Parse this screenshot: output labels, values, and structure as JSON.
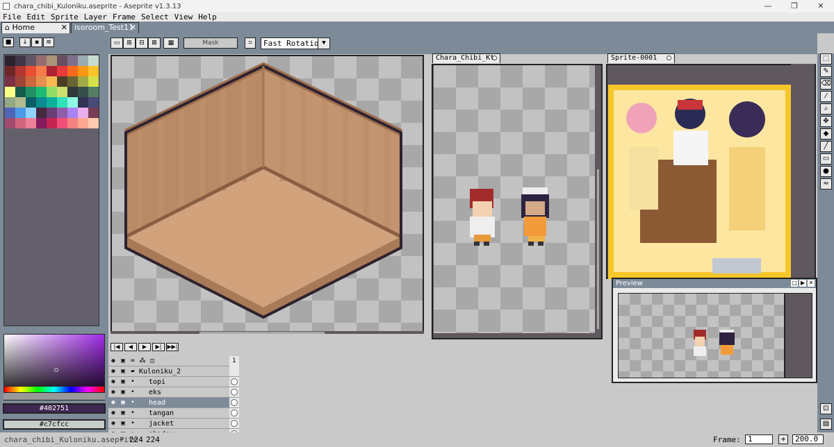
{
  "window": {
    "title": "chara_chibi_Kuloniku.aseprite - Aseprite v1.3.13",
    "controls": [
      "—",
      "❐",
      "✕"
    ]
  },
  "menu": [
    "File",
    "Edit",
    "Sprite",
    "Layer",
    "Frame",
    "Select",
    "View",
    "Help"
  ],
  "tabs": [
    {
      "label": "Home",
      "close": "✕"
    },
    {
      "label": "isoroom_Test11",
      "close": "✕"
    }
  ],
  "toolbar": {
    "mask_label": "Mask",
    "rotation_value": "Fast Rotation"
  },
  "doc_tabs": [
    "Chara_Chibi_Kt",
    "Sprite-0001"
  ],
  "colors": {
    "foreground_hex": "#402751",
    "background_hex": "#c7cfcc",
    "accent": "#7d8b99"
  },
  "palette": [
    "#2e222f",
    "#3e3546",
    "#625565",
    "#966c6c",
    "#ab947a",
    "#694f62",
    "#7f708a",
    "#9babb2",
    "#c7dcd0",
    "#6e2727",
    "#b33831",
    "#ea4f36",
    "#f57d4a",
    "#ae2334",
    "#e83b3b",
    "#fb6b1d",
    "#f79617",
    "#f9c22b",
    "#7a3045",
    "#9e4539",
    "#cd683d",
    "#e6904e",
    "#fbb954",
    "#4c3e24",
    "#676633",
    "#a2a947",
    "#d5e04b",
    "#fbff86",
    "#165a4c",
    "#239063",
    "#1ebc73",
    "#91db69",
    "#cddf6c",
    "#313638",
    "#374e4a",
    "#547e64",
    "#92a984",
    "#b2ba90",
    "#0b5e65",
    "#0b8a8f",
    "#0eaf9b",
    "#30e1b9",
    "#8ff8e2",
    "#323353",
    "#484a77",
    "#4d65b4",
    "#4d9be6",
    "#8fd3ff",
    "#45293f",
    "#6b3e75",
    "#905ea9",
    "#a884f3",
    "#eaaded",
    "#753c54",
    "#a24b6f",
    "#cf657f",
    "#ed8099",
    "#831c5d",
    "#c32454",
    "#f04f78",
    "#f68181",
    "#fca790",
    "#fdcbb0"
  ],
  "timeline": {
    "frame_header": "1",
    "layers": [
      {
        "name": "Kuloniku_2",
        "group": true,
        "selected": false
      },
      {
        "name": "topi",
        "group": false,
        "selected": false
      },
      {
        "name": "eks",
        "group": false,
        "selected": false
      },
      {
        "name": "head",
        "group": false,
        "selected": true
      },
      {
        "name": "tangan",
        "group": false,
        "selected": false
      },
      {
        "name": "jacket",
        "group": false,
        "selected": false
      },
      {
        "name": "shadow",
        "group": false,
        "selected": false
      }
    ]
  },
  "preview": {
    "title": "Preview"
  },
  "status": {
    "filename": "chara_chibi_Kuloniku.aseprite",
    "size_w": "224",
    "size_h": "224",
    "frame_label": "Frame:",
    "frame_value": "1",
    "zoom_value": "200.0"
  },
  "icons": [
    "lock-icon",
    "eye-icon",
    "folder-icon",
    "play-icon",
    "first-frame-icon",
    "last-frame-icon",
    "marquee-icon",
    "pencil-icon",
    "eraser-icon",
    "eyedropper-icon",
    "zoom-icon",
    "move-icon",
    "bucket-icon",
    "line-icon",
    "rectangle-icon",
    "ellipse-icon",
    "blur-icon"
  ]
}
